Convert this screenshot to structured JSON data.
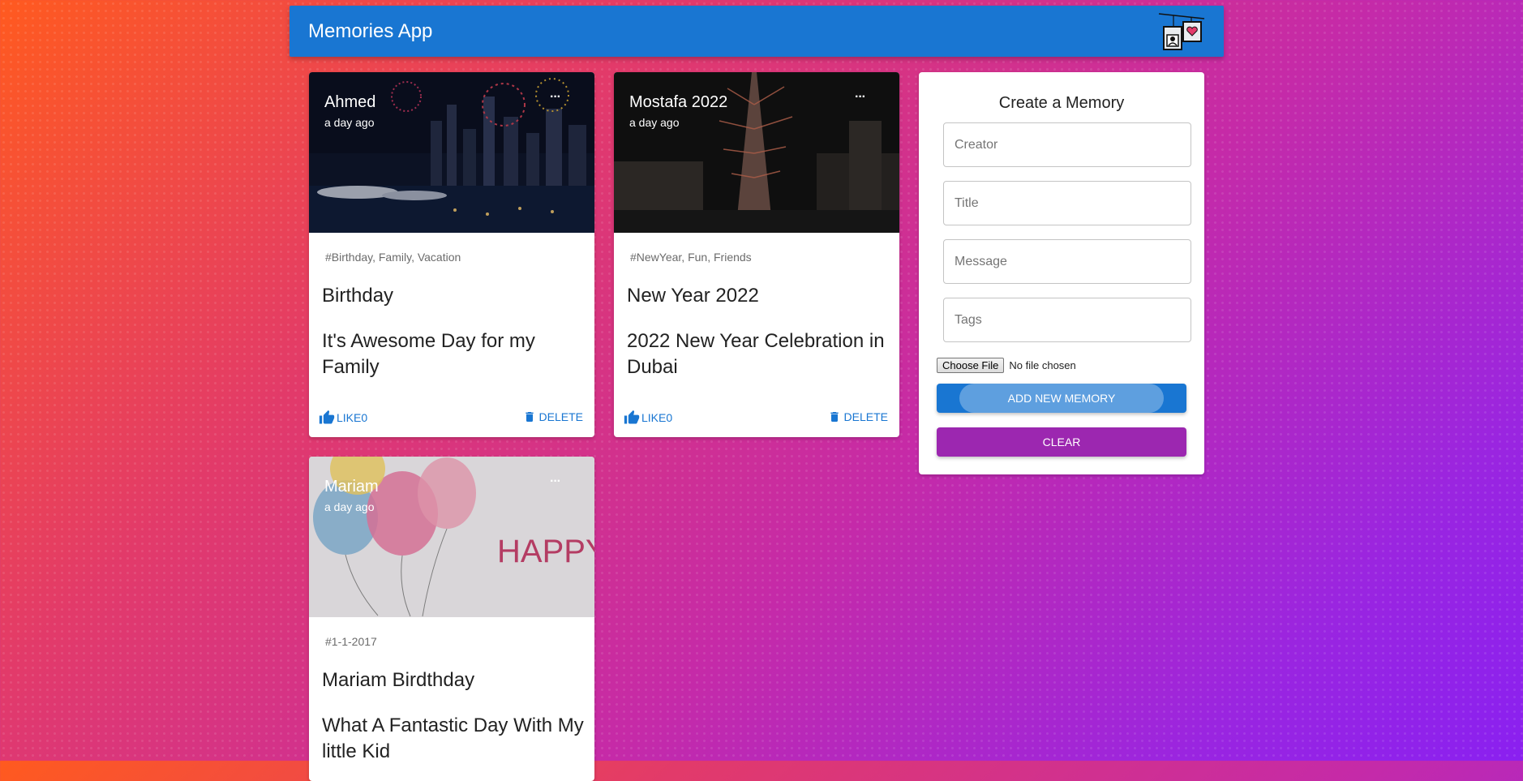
{
  "app": {
    "title": "Memories App"
  },
  "posts": [
    {
      "creator": "Ahmed",
      "time": "a day ago",
      "more": "···",
      "tags": "#Birthday, Family, Vacation",
      "title": "Birthday",
      "message": "It's Awesome Day for my Family",
      "like_label": "LIKE0",
      "delete_label": "DELETE"
    },
    {
      "creator": "Mostafa 2022",
      "time": "a day ago",
      "more": "···",
      "tags": "#NewYear, Fun, Friends",
      "title": "New Year 2022",
      "message": "2022 New Year Celebration in Dubai",
      "like_label": "LIKE0",
      "delete_label": "DELETE"
    },
    {
      "creator": "Mariam",
      "time": "a day ago",
      "more": "···",
      "tags": "#1-1-2017",
      "title": "Mariam Birdthday",
      "message": "What A Fantastic Day With My little Kid",
      "image_text": "HAPPY BIRTHDAY!"
    }
  ],
  "form": {
    "title": "Create a Memory",
    "creator_placeholder": "Creator",
    "title_placeholder": "Title",
    "message_placeholder": "Message",
    "tags_placeholder": "Tags",
    "file_button": "Choose File",
    "file_status": "No file chosen",
    "submit_label": "ADD NEW MEMORY",
    "clear_label": "CLEAR"
  },
  "colors": {
    "primary": "#1976d2",
    "secondary": "#9c27b0"
  }
}
